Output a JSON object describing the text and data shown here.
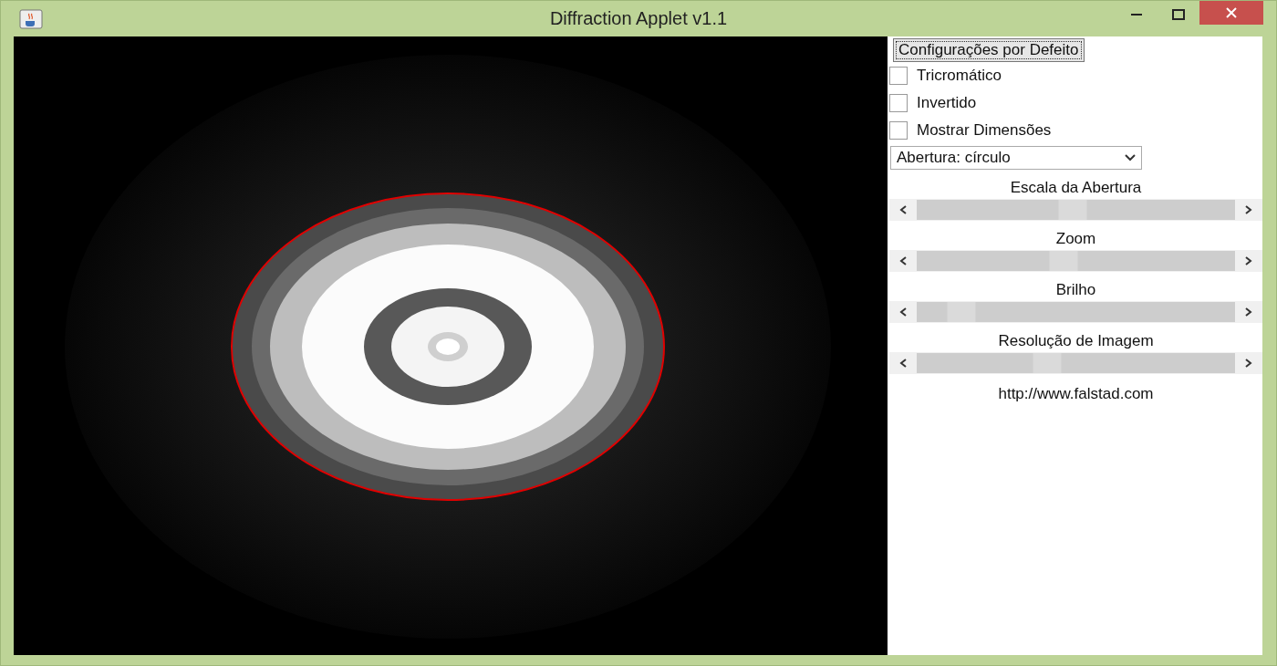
{
  "window": {
    "title": "Diffraction Applet v1.1"
  },
  "default_button": {
    "label": "Configurações por Defeito"
  },
  "checkboxes": [
    {
      "label": "Tricromático",
      "checked": false
    },
    {
      "label": "Invertido",
      "checked": false
    },
    {
      "label": "Mostrar Dimensões",
      "checked": false
    }
  ],
  "aperture_select": {
    "value": "Abertura: círculo"
  },
  "sliders": [
    {
      "label": "Escala da Abertura",
      "level": 0.49
    },
    {
      "label": "Zoom",
      "level": 0.46
    },
    {
      "label": "Brilho",
      "level": 0.14
    },
    {
      "label": "Resolução de Imagem",
      "level": 0.41
    }
  ],
  "link": "http://www.falstad.com"
}
